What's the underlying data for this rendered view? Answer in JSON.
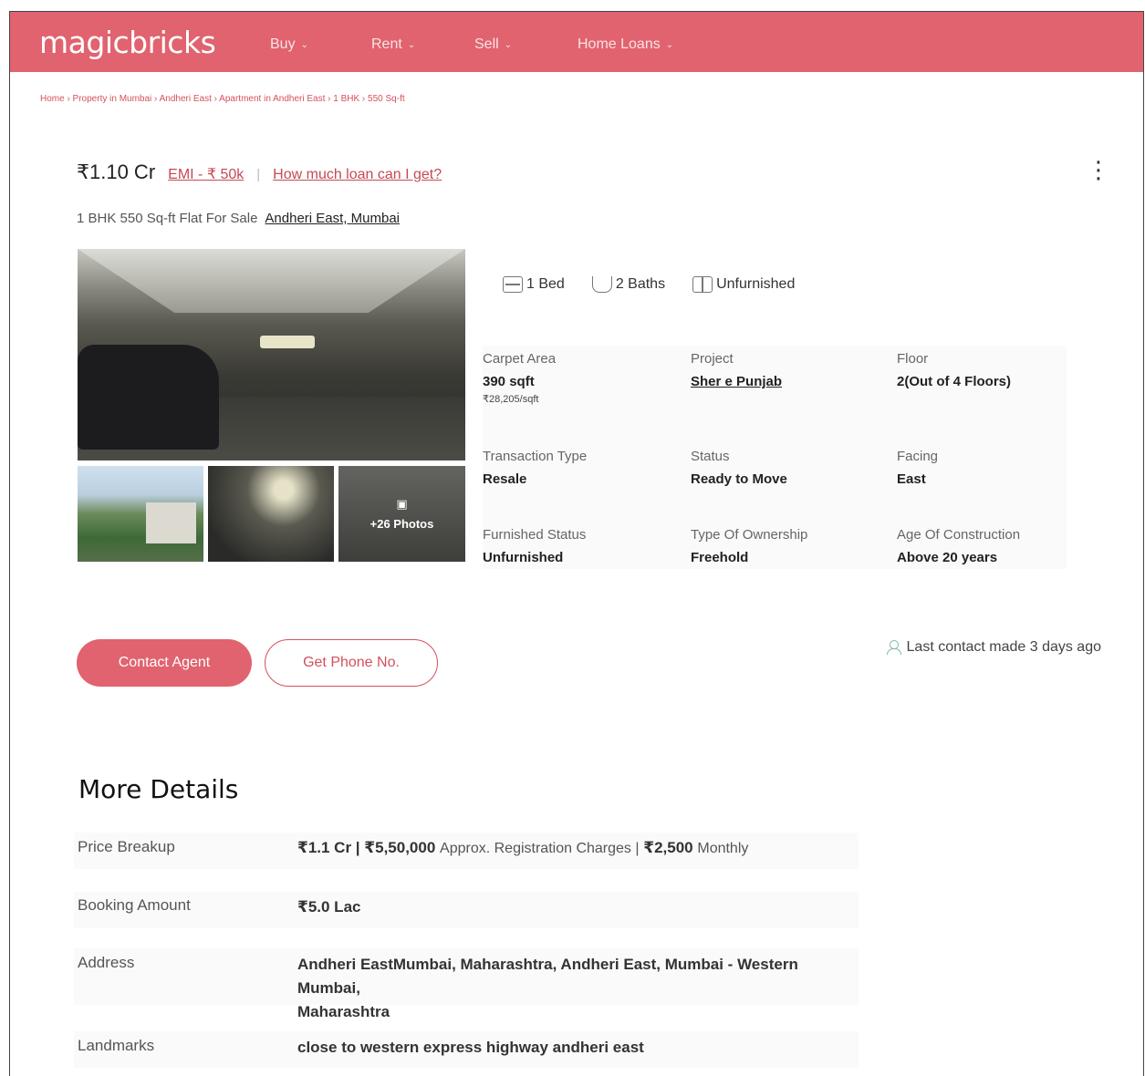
{
  "nav": {
    "logo": "magicbricks",
    "items": [
      "Buy",
      "Rent",
      "Sell",
      "Home Loans"
    ]
  },
  "breadcrumb": "Home › Property in Mumbai › Andheri East › Apartment in Andheri East › 1 BHK › 550 Sq-ft",
  "header": {
    "price": "₹1.10 Cr",
    "emi": "EMI - ₹ 50k",
    "separator": "|",
    "loan_link": "How much loan can I get?",
    "title": "1 BHK 550 Sq-ft Flat For Sale",
    "location": "Andheri East, Mumbai"
  },
  "gallery": {
    "more_photos": "+26 Photos"
  },
  "amenities": {
    "bed": "1 Bed",
    "baths": "2 Baths",
    "furnishing": "Unfurnished"
  },
  "details": {
    "carpet_area": {
      "label": "Carpet Area",
      "value": "390 sqft",
      "sub": "₹28,205/sqft"
    },
    "project": {
      "label": "Project",
      "value": "Sher e Punjab"
    },
    "floor": {
      "label": "Floor",
      "value": "2(Out of 4 Floors)"
    },
    "transaction": {
      "label": "Transaction Type",
      "value": "Resale"
    },
    "status": {
      "label": "Status",
      "value": "Ready to Move"
    },
    "facing": {
      "label": "Facing",
      "value": "East"
    },
    "furnished": {
      "label": "Furnished Status",
      "value": "Unfurnished"
    },
    "ownership": {
      "label": "Type Of Ownership",
      "value": "Freehold"
    },
    "age": {
      "label": "Age Of Construction",
      "value": "Above 20 years"
    }
  },
  "actions": {
    "contact_agent": "Contact Agent",
    "get_phone": "Get Phone No.",
    "last_contact": "Last contact made 3 days ago"
  },
  "more_details": {
    "title": "More Details",
    "price_breakup": {
      "label": "Price Breakup",
      "price": "₹1.1 Cr | ₹5,50,000",
      "reg_label": "Approx. Registration Charges |",
      "monthly_amt": "₹2,500",
      "monthly_label": "Monthly"
    },
    "booking": {
      "label": "Booking Amount",
      "value": "₹5.0 Lac"
    },
    "address": {
      "label": "Address",
      "line1": "Andheri EastMumbai, Maharashtra, Andheri East, Mumbai - Western Mumbai,",
      "line2": "Maharashtra"
    },
    "landmarks": {
      "label": "Landmarks",
      "value": "close to western express highway andheri east"
    }
  },
  "colors": {
    "brand": "#e0636f",
    "link": "#c44a55"
  }
}
